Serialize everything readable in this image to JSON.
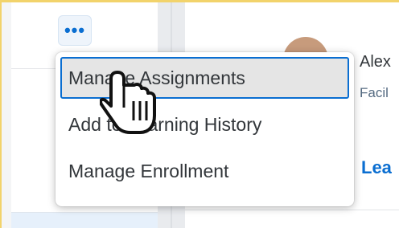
{
  "more_button": {
    "label": "•••"
  },
  "menu": {
    "items": [
      {
        "label": "Manage Assignments",
        "selected": true
      },
      {
        "label": "Add to Learning History",
        "selected": false
      },
      {
        "label": "Manage Enrollment",
        "selected": false
      }
    ]
  },
  "detail": {
    "name_partial": "Alex",
    "role_partial": "Facil",
    "tab_partial": "Lea"
  },
  "colors": {
    "accent": "#0a6ed1",
    "selected_bg": "#e5e5e5",
    "highlight_frame": "#f2d36b"
  },
  "icons": {
    "cursor": "hand-pointer-icon",
    "avatar": "user-avatar"
  }
}
